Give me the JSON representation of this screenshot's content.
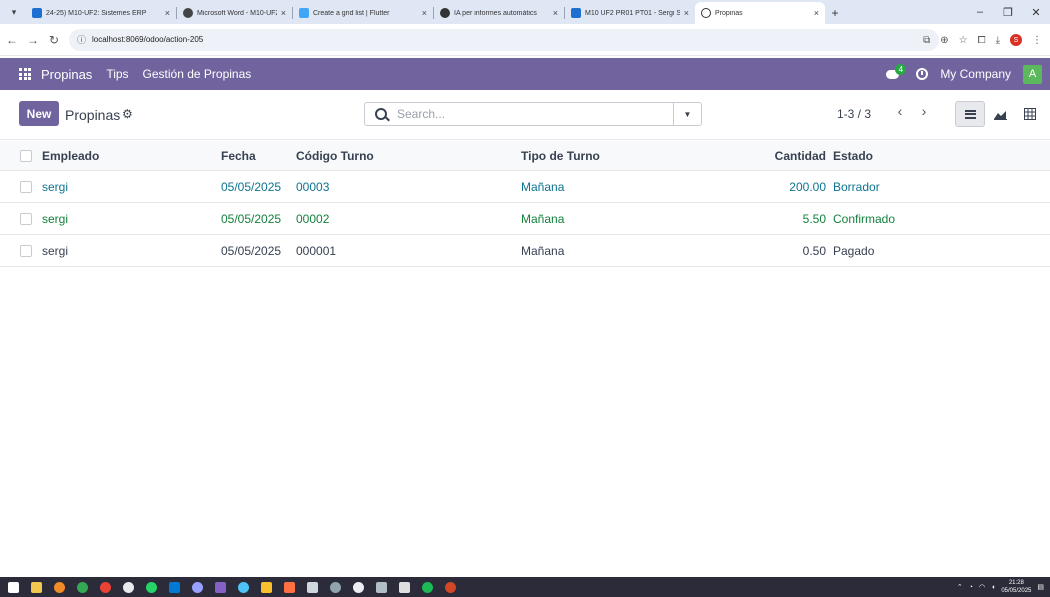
{
  "browser": {
    "tabs": [
      {
        "title": "24-25) M10-UF2: Sistemes ERP",
        "fav": "#1f6fd1"
      },
      {
        "title": "Microsoft Word - M10-UF2-Mc",
        "fav": "#444444"
      },
      {
        "title": "Create a grid list | Flutter",
        "fav": "#43a5f5"
      },
      {
        "title": "IA per informes automàtics",
        "fav": "#333333"
      },
      {
        "title": "M10 UF2 PR01 PT01 - Sergi Sa",
        "fav": "#1f6fd1"
      },
      {
        "title": "Propinas",
        "fav": "#ffffff"
      }
    ],
    "url": "localhost:8069/odoo/action-205"
  },
  "navbar": {
    "brand": "Propinas",
    "menu": [
      "Tips",
      "Gestión de Propinas"
    ],
    "chat_count": "4",
    "company": "My Company",
    "avatar_letter": "A"
  },
  "control_panel": {
    "new_label": "New",
    "breadcrumb": "Propinas",
    "search_placeholder": "Search...",
    "pager": "1-3 / 3"
  },
  "table": {
    "headers": {
      "empleado": "Empleado",
      "fecha": "Fecha",
      "codigo": "Código Turno",
      "tipo": "Tipo de Turno",
      "cantidad": "Cantidad",
      "estado": "Estado"
    },
    "rows": [
      {
        "empleado": "sergi",
        "fecha": "05/05/2025",
        "codigo": "00003",
        "tipo": "Mañana",
        "cantidad": "200.00",
        "estado": "Borrador",
        "color": "#0e7490"
      },
      {
        "empleado": "sergi",
        "fecha": "05/05/2025",
        "codigo": "00002",
        "tipo": "Mañana",
        "cantidad": "5.50",
        "estado": "Confirmado",
        "color": "#15803d"
      },
      {
        "empleado": "sergi",
        "fecha": "05/05/2025",
        "codigo": "000001",
        "tipo": "Mañana",
        "cantidad": "0.50",
        "estado": "Pagado",
        "color": "#374151"
      }
    ]
  },
  "taskbar": {
    "time": "21:28",
    "date": "05/05/2025"
  },
  "colors": {
    "brand": "#71639e",
    "avatar": "#5cb85c",
    "badge": "#28a745"
  }
}
